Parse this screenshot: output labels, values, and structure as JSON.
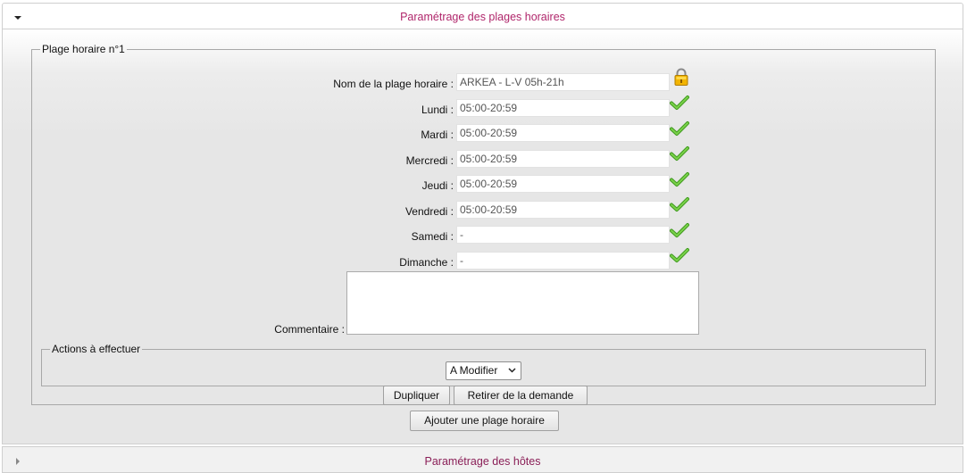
{
  "section1": {
    "title": "Paramétrage des plages horaires"
  },
  "plage": {
    "legend": "Plage horaire n°1",
    "name_label": "Nom de la plage horaire :",
    "name_value": "ARKEA - L-V 05h-21h",
    "days": [
      {
        "label": "Lundi :",
        "value": "05:00-20:59"
      },
      {
        "label": "Mardi :",
        "value": "05:00-20:59"
      },
      {
        "label": "Mercredi :",
        "value": "05:00-20:59"
      },
      {
        "label": "Jeudi :",
        "value": "05:00-20:59"
      },
      {
        "label": "Vendredi :",
        "value": "05:00-20:59"
      },
      {
        "label": "Samedi :",
        "value": "-"
      },
      {
        "label": "Dimanche :",
        "value": "-"
      }
    ],
    "comment_label": "Commentaire :",
    "comment_value": "",
    "actions_legend": "Actions à effectuer",
    "action_selected": "A Modifier",
    "duplicate_label": "Dupliquer",
    "remove_label": "Retirer de la demande"
  },
  "add_plage_label": "Ajouter une plage horaire",
  "section2": {
    "title": "Paramétrage des hôtes"
  },
  "colors": {
    "accent": "#b0266b",
    "check": "#5cb82e"
  },
  "icons": {
    "expanded": "triangle-down-icon",
    "collapsed": "triangle-right-icon",
    "valid": "checkmark-icon",
    "locked": "padlock-icon"
  }
}
